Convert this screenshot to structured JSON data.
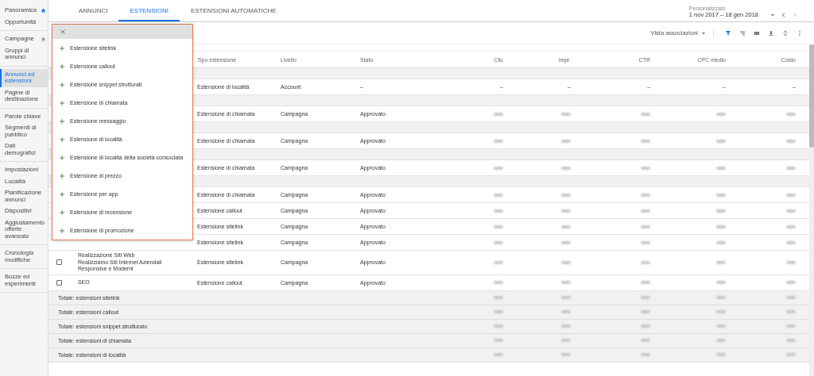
{
  "sidebar": {
    "groups": [
      [
        {
          "label": "Panoramica",
          "selected": false,
          "home_icon_active": true
        },
        {
          "label": "Opportunità",
          "selected": false
        }
      ],
      [
        {
          "label": "Campagne",
          "selected": false,
          "home_icon_active": false
        },
        {
          "label": "Gruppi di annunci",
          "selected": false
        }
      ],
      [
        {
          "label": "Annunci ed estensioni",
          "selected": true
        },
        {
          "label": "Pagine di destinazione",
          "selected": false
        }
      ],
      [
        {
          "label": "Parole chiave",
          "selected": false
        },
        {
          "label": "Segmenti di pubblico",
          "selected": false
        },
        {
          "label": "Dati demografici",
          "selected": false
        }
      ],
      [
        {
          "label": "Impostazioni",
          "selected": false
        },
        {
          "label": "Località",
          "selected": false
        },
        {
          "label": "Pianificazione annunci",
          "selected": false
        },
        {
          "label": "Dispositivi",
          "selected": false
        },
        {
          "label": "Aggiustamento offerte avanzato",
          "selected": false
        }
      ],
      [
        {
          "label": "Cronologia modifiche",
          "selected": false
        }
      ],
      [
        {
          "label": "Bozze ed esperimenti",
          "selected": false
        }
      ]
    ]
  },
  "tabs": [
    {
      "label": "ANNUNCI",
      "selected": false
    },
    {
      "label": "ESTENSIONI",
      "selected": true
    },
    {
      "label": "ESTENSIONI AUTOMATICHE",
      "selected": false
    }
  ],
  "date_range": {
    "label": "Personalizzato",
    "value": "1 nov 2017 – 18 gen 2018"
  },
  "toolbar": {
    "view": "Vista associazioni"
  },
  "table": {
    "columns": [
      "Tipo estensione",
      "Livello",
      "Stato",
      "Clic",
      "Impr.",
      "CTR",
      "CPC medio",
      "Costo"
    ],
    "rows": [
      {
        "kind": "group"
      },
      {
        "kind": "data",
        "tipo": "Estensione di località",
        "livello": "Account",
        "stato": "–",
        "metrics": [
          "–",
          "–",
          "–",
          "–",
          "–"
        ]
      },
      {
        "kind": "group"
      },
      {
        "kind": "data",
        "tipo": "Estensione di chiamata",
        "livello": "Campagna",
        "stato": "Approvato",
        "blurred": true
      },
      {
        "kind": "group"
      },
      {
        "kind": "data",
        "tipo": "Estensione di chiamata",
        "livello": "Campagna",
        "stato": "Approvato",
        "blurred": true
      },
      {
        "kind": "group"
      },
      {
        "kind": "data",
        "tipo": "Estensione di chiamata",
        "livello": "Campagna",
        "stato": "Approvato",
        "blurred": true
      },
      {
        "kind": "group"
      },
      {
        "kind": "data",
        "tipo": "Estensione di chiamata",
        "livello": "Campagna",
        "stato": "Approvato",
        "blurred": true
      },
      {
        "kind": "data",
        "tipo": "Estensione callout",
        "livello": "Campagna",
        "stato": "Approvato",
        "blurred": true
      },
      {
        "kind": "data",
        "tipo": "Estensione sitelink",
        "livello": "Campagna",
        "stato": "Approvato",
        "blurred": true
      },
      {
        "kind": "data",
        "tipo": "Estensione sitelink",
        "livello": "Campagna",
        "stato": "Approvato",
        "blurred": true
      },
      {
        "kind": "data",
        "checked": false,
        "name": "Realizzazione Siti Web\nRealizziamo Siti Internet Aziendali\nResponsive e Moderni",
        "tipo": "Estensione sitelink",
        "livello": "Campagna",
        "stato": "Approvato",
        "blurred": true
      },
      {
        "kind": "data",
        "checked": false,
        "name": "SEO",
        "tipo": "Estensione callout",
        "livello": "Campagna",
        "stato": "Approvato",
        "blurred": true
      },
      {
        "kind": "total",
        "label": "Totale: estensioni sitelink",
        "blurred": true
      },
      {
        "kind": "total",
        "label": "Totale: estensioni callout",
        "blurred": true
      },
      {
        "kind": "total",
        "label": "Totale: estensioni snippet strutturato",
        "blurred": true
      },
      {
        "kind": "total",
        "label": "Totale: estensioni di chiamata",
        "blurred": true
      },
      {
        "kind": "total",
        "label": "Totale: estensioni di località",
        "blurred": true
      }
    ]
  },
  "menu": {
    "items": [
      "Estensione sitelink",
      "Estensione callout",
      "Estensione snippet strutturati",
      "Estensione di chiamata",
      "Estensione messaggio",
      "Estensione di località",
      "Estensione di località della società consociata",
      "Estensione di prezzo",
      "Estensione per app",
      "Estensione di recensione",
      "Estensione di promozione"
    ]
  }
}
